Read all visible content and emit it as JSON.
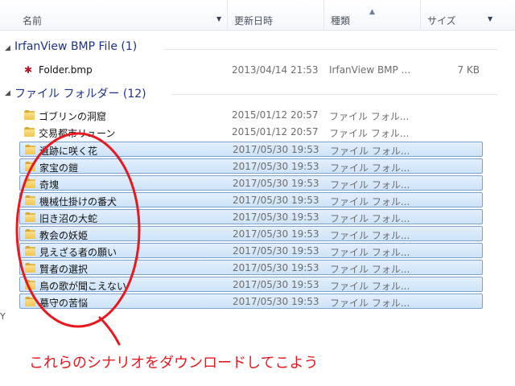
{
  "columns": {
    "name": "名前",
    "date": "更新日時",
    "type": "種類",
    "size": "サイズ"
  },
  "groups": [
    {
      "header": "IrfanView BMP File (1)",
      "items": [
        {
          "name": "Folder.bmp",
          "date": "2013/04/14 21:53",
          "type": "IrfanView BMP ...",
          "size": "7 KB",
          "icon": "bmp-file-icon",
          "selected": false
        }
      ]
    },
    {
      "header": "ファイル フォルダー (12)",
      "items": [
        {
          "name": "ゴブリンの洞窟",
          "date": "2015/01/12 20:57",
          "type": "ファイル フォル...",
          "icon": "folder-icon",
          "selected": false
        },
        {
          "name": "交易都市リューン",
          "date": "2015/01/12 20:57",
          "type": "ファイル フォル...",
          "icon": "folder-icon",
          "selected": false
        },
        {
          "name": "遺跡に咲く花",
          "date": "2017/05/30 19:53",
          "type": "ファイル フォル...",
          "icon": "folder-icon",
          "selected": true
        },
        {
          "name": "家宝の鎧",
          "date": "2017/05/30 19:53",
          "type": "ファイル フォル...",
          "icon": "folder-icon",
          "selected": true
        },
        {
          "name": "奇塊",
          "date": "2017/05/30 19:53",
          "type": "ファイル フォル...",
          "icon": "folder-icon",
          "selected": true
        },
        {
          "name": "機械仕掛けの番犬",
          "date": "2017/05/30 19:53",
          "type": "ファイル フォル...",
          "icon": "folder-icon",
          "selected": true
        },
        {
          "name": "旧き沼の大蛇",
          "date": "2017/05/30 19:53",
          "type": "ファイル フォル...",
          "icon": "folder-icon",
          "selected": true
        },
        {
          "name": "教会の妖姫",
          "date": "2017/05/30 19:53",
          "type": "ファイル フォル...",
          "icon": "folder-icon",
          "selected": true
        },
        {
          "name": "見えざる者の願い",
          "date": "2017/05/30 19:53",
          "type": "ファイル フォル...",
          "icon": "folder-icon",
          "selected": true
        },
        {
          "name": "賢者の選択",
          "date": "2017/05/30 19:53",
          "type": "ファイル フォル...",
          "icon": "folder-icon",
          "selected": true
        },
        {
          "name": "鳥の歌が聞こえない",
          "date": "2017/05/30 19:53",
          "type": "ファイル フォル...",
          "icon": "folder-icon",
          "selected": true
        },
        {
          "name": "墓守の苦悩",
          "date": "2017/05/30 19:53",
          "type": "ファイル フォル...",
          "icon": "folder-icon",
          "selected": true
        }
      ]
    }
  ],
  "left_edge_text": "Y",
  "annotation": {
    "text": "これらのシナリオをダウンロードしてこよう",
    "color": "#e8181e"
  }
}
